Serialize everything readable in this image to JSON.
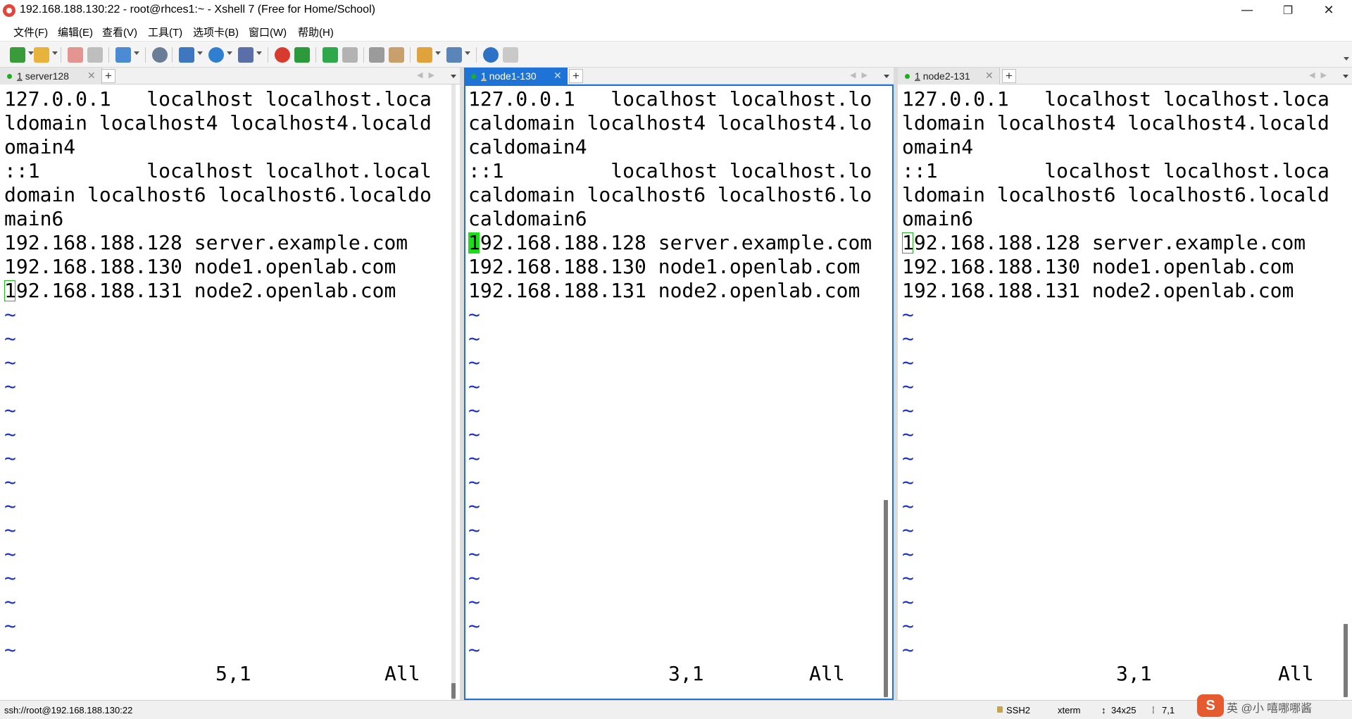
{
  "window": {
    "title": "192.168.188.130:22 - root@rhces1:~ - Xshell 7 (Free for Home/School)",
    "minimize": "—",
    "restore": "❐",
    "close": "✕"
  },
  "menu": [
    "文件(F)",
    "编辑(E)",
    "查看(V)",
    "工具(T)",
    "选项卡(B)",
    "窗口(W)",
    "帮助(H)"
  ],
  "panes": [
    {
      "tab_num": "1",
      "tab_name": "server128",
      "active": false,
      "lines": [
        "127.0.0.1   localhost localhost.loca",
        "ldomain localhost4 localhost4.locald",
        "omain4",
        "::1         localhost localhot.local",
        "domain localhost6 localhost6.localdo",
        "main6",
        "192.168.188.128 server.example.com",
        "192.168.188.130 node1.openlab.com",
        "192.168.188.131 node2.openlab.com"
      ],
      "tilde_count": 15,
      "position": "5,1",
      "scope": "All"
    },
    {
      "tab_num": "1",
      "tab_name": "node1-130",
      "active": true,
      "lines": [
        "127.0.0.1   localhost localhost.lo",
        "caldomain localhost4 localhost4.lo",
        "caldomain4",
        "::1         localhost localhost.lo",
        "caldomain localhost6 localhost6.lo",
        "caldomain6",
        "192.168.188.128 server.example.com",
        "192.168.188.130 node1.openlab.com",
        "192.168.188.131 node2.openlab.com"
      ],
      "tilde_count": 15,
      "position": "3,1",
      "scope": "All"
    },
    {
      "tab_num": "1",
      "tab_name": "node2-131",
      "active": false,
      "lines": [
        "127.0.0.1   localhost localhost.loca",
        "ldomain localhost4 localhost4.locald",
        "omain4",
        "::1         localhost localhost.loca",
        "ldomain localhost6 localhost6.locald",
        "omain6",
        "192.168.188.128 server.example.com",
        "192.168.188.130 node1.openlab.com",
        "192.168.188.131 node2.openlab.com"
      ],
      "tilde_count": 15,
      "position": "3,1",
      "scope": "All"
    }
  ],
  "statusbar": {
    "connection": "ssh://root@192.168.188.130:22",
    "protocol": "SSH2",
    "terminal": "xterm",
    "size": "34x25",
    "cursor": "7,1"
  },
  "tray_text": "英 @小 嘻哪哪酱",
  "csdn_text": "S",
  "colors": {
    "accent": "#1e73d6",
    "cursor": "#18e018",
    "tilde": "#1a2fd1",
    "status_dot": "#19b21e"
  }
}
